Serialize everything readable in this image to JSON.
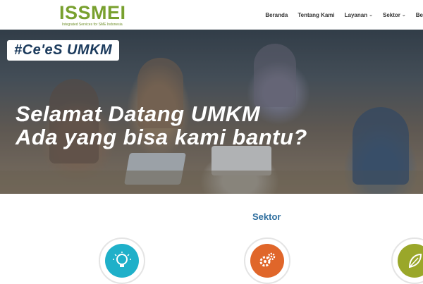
{
  "brand": {
    "logo_text": "ISSMEI",
    "tagline": "Integrated Services for SME Indonesia",
    "accent": "#78a02e"
  },
  "nav": {
    "items": [
      {
        "label": "Beranda",
        "has_dropdown": false
      },
      {
        "label": "Tentang Kami",
        "has_dropdown": false
      },
      {
        "label": "Layanan",
        "has_dropdown": true
      },
      {
        "label": "Sektor",
        "has_dropdown": true
      },
      {
        "label": "Be",
        "has_dropdown": false
      }
    ]
  },
  "hero": {
    "tag": "#Ce'eS UMKM",
    "headline_line1": "Selamat Datang UMKM",
    "headline_line2": "Ada yang bisa kami bantu?"
  },
  "sektor": {
    "title": "Sektor",
    "icons": [
      {
        "name": "lightbulb-icon",
        "color": "#1fb0c9"
      },
      {
        "name": "gears-icon",
        "color": "#e0662a"
      },
      {
        "name": "leaf-icon",
        "color": "#9aa72a"
      }
    ]
  },
  "colors": {
    "heading_blue": "#2f6f9f",
    "tag_text": "#1b3a5c"
  }
}
